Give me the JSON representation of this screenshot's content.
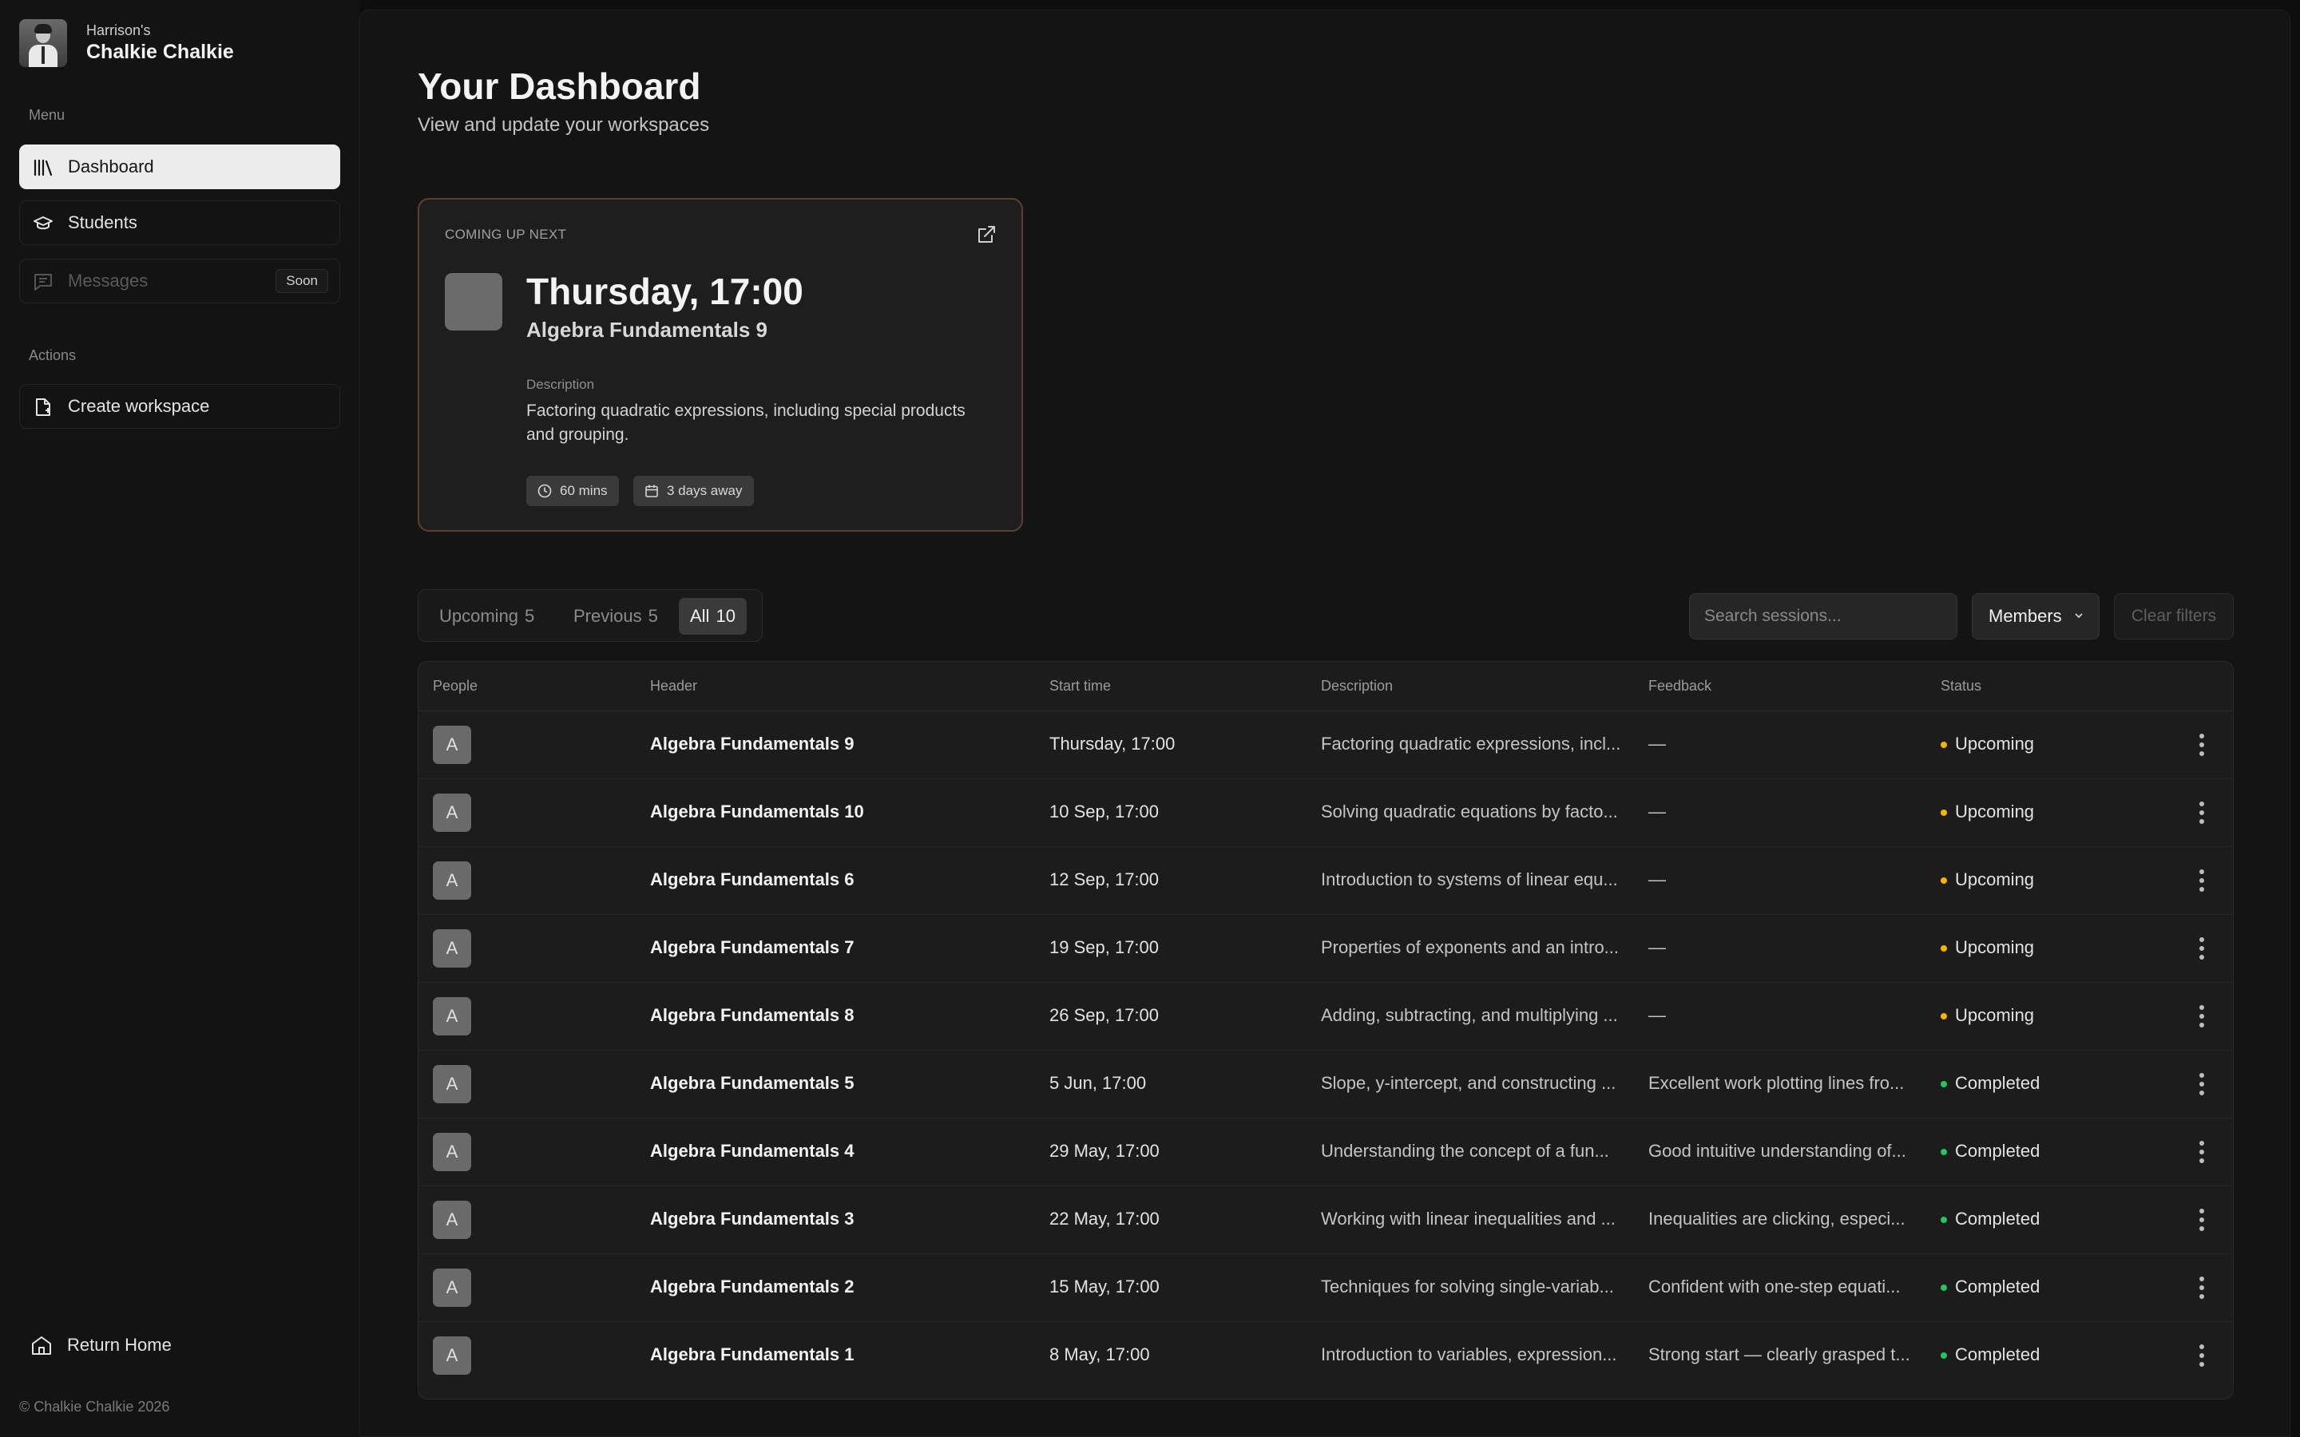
{
  "brand": {
    "owner": "Harrison's",
    "name": "Chalkie Chalkie"
  },
  "sidebar": {
    "menu_label": "Menu",
    "items": [
      {
        "label": "Dashboard",
        "icon": "library-icon",
        "active": true
      },
      {
        "label": "Students",
        "icon": "graduation-cap-icon"
      },
      {
        "label": "Messages",
        "icon": "message-icon",
        "badge": "Soon",
        "disabled": true
      }
    ],
    "actions_label": "Actions",
    "actions": [
      {
        "label": "Create workspace",
        "icon": "file-plus-icon"
      }
    ],
    "return_home": "Return Home",
    "copyright": "© Chalkie Chalkie 2026"
  },
  "header": {
    "title": "Your Dashboard",
    "subtitle": "View and update your workspaces"
  },
  "next_session": {
    "label": "COMING UP NEXT",
    "time": "Thursday, 17:00",
    "title": "Algebra Fundamentals 9",
    "description_label": "Description",
    "description": "Factoring quadratic expressions, including special products and grouping.",
    "duration": "60 mins",
    "due": "3 days away"
  },
  "tabs": [
    {
      "label": "Upcoming",
      "count": "5"
    },
    {
      "label": "Previous",
      "count": "5"
    },
    {
      "label": "All",
      "count": "10",
      "active": true
    }
  ],
  "filters": {
    "search_placeholder": "Search sessions...",
    "members_label": "Members",
    "clear_label": "Clear filters"
  },
  "table": {
    "columns": [
      "People",
      "Header",
      "Start time",
      "Description",
      "Feedback",
      "Status"
    ],
    "rows": [
      {
        "avatar": "A",
        "header": "Algebra Fundamentals 9",
        "start": "Thursday, 17:00",
        "description": "Factoring quadratic expressions, incl...",
        "feedback": "—",
        "status": "Upcoming"
      },
      {
        "avatar": "A",
        "header": "Algebra Fundamentals 10",
        "start": "10 Sep, 17:00",
        "description": "Solving quadratic equations by facto...",
        "feedback": "—",
        "status": "Upcoming"
      },
      {
        "avatar": "A",
        "header": "Algebra Fundamentals 6",
        "start": "12 Sep, 17:00",
        "description": "Introduction to systems of linear equ...",
        "feedback": "—",
        "status": "Upcoming"
      },
      {
        "avatar": "A",
        "header": "Algebra Fundamentals 7",
        "start": "19 Sep, 17:00",
        "description": "Properties of exponents and an intro...",
        "feedback": "—",
        "status": "Upcoming"
      },
      {
        "avatar": "A",
        "header": "Algebra Fundamentals 8",
        "start": "26 Sep, 17:00",
        "description": "Adding, subtracting, and multiplying ...",
        "feedback": "—",
        "status": "Upcoming"
      },
      {
        "avatar": "A",
        "header": "Algebra Fundamentals 5",
        "start": "5 Jun, 17:00",
        "description": "Slope, y-intercept, and constructing ...",
        "feedback": "Excellent work plotting lines fro...",
        "status": "Completed"
      },
      {
        "avatar": "A",
        "header": "Algebra Fundamentals 4",
        "start": "29 May, 17:00",
        "description": "Understanding the concept of a fun...",
        "feedback": "Good intuitive understanding of...",
        "status": "Completed"
      },
      {
        "avatar": "A",
        "header": "Algebra Fundamentals 3",
        "start": "22 May, 17:00",
        "description": "Working with linear inequalities and ...",
        "feedback": "Inequalities are clicking, especi...",
        "status": "Completed"
      },
      {
        "avatar": "A",
        "header": "Algebra Fundamentals 2",
        "start": "15 May, 17:00",
        "description": "Techniques for solving single-variab...",
        "feedback": "Confident with one-step equati...",
        "status": "Completed"
      },
      {
        "avatar": "A",
        "header": "Algebra Fundamentals 1",
        "start": "8 May, 17:00",
        "description": "Introduction to variables, expression...",
        "feedback": "Strong start — clearly grasped t...",
        "status": "Completed"
      }
    ]
  },
  "colors": {
    "upcoming": "#f5b400",
    "completed": "#22c55e",
    "card_border": "#5a3f33"
  }
}
